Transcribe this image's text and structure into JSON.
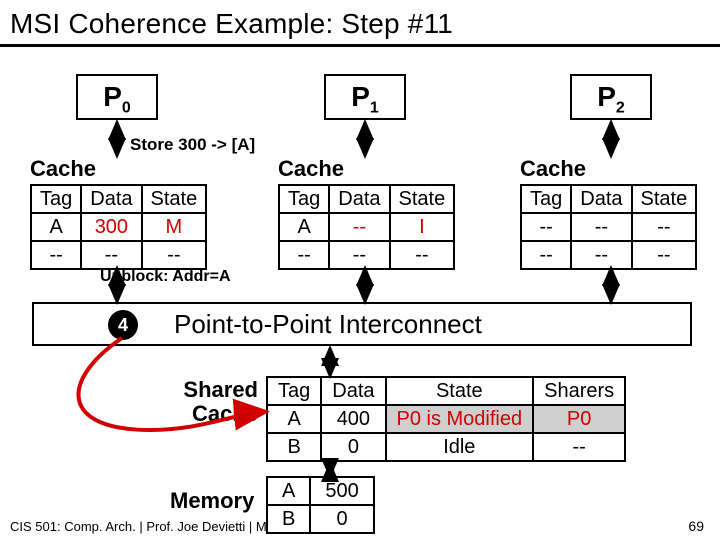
{
  "title": "MSI Coherence Example: Step #11",
  "processors": {
    "p0": "P",
    "p0sub": "0",
    "p1": "P",
    "p1sub": "1",
    "p2": "P",
    "p2sub": "2"
  },
  "store_note": "Store 300 -> [A]",
  "unblock_note": "Unblock: Addr=A",
  "cache_label": "Cache",
  "cache_headers": {
    "tag": "Tag",
    "data": "Data",
    "state": "State"
  },
  "cache0": {
    "r0": {
      "tag": "A",
      "data": "300",
      "state": "M"
    },
    "r1": {
      "tag": "--",
      "data": "--",
      "state": "--"
    }
  },
  "cache1": {
    "r0": {
      "tag": "A",
      "data": "--",
      "state": "I"
    },
    "r1": {
      "tag": "--",
      "data": "--",
      "state": "--"
    }
  },
  "cache2": {
    "r0": {
      "tag": "--",
      "data": "--",
      "state": "--"
    },
    "r1": {
      "tag": "--",
      "data": "--",
      "state": "--"
    }
  },
  "badge4": "4",
  "interconnect": "Point-to-Point Interconnect",
  "shared_label_l1": "Shared",
  "shared_label_l2": "Cache",
  "shared_headers": {
    "tag": "Tag",
    "data": "Data",
    "state": "State",
    "sharers": "Sharers"
  },
  "shared": {
    "r0": {
      "tag": "A",
      "data": "400",
      "state": "P0 is Modified",
      "sharers": "P0"
    },
    "r1": {
      "tag": "B",
      "data": "0",
      "state": "Idle",
      "sharers": "--"
    }
  },
  "memory_label": "Memory",
  "memory": {
    "r0": {
      "tag": "A",
      "data": "500"
    },
    "r1": {
      "tag": "B",
      "data": "0"
    }
  },
  "footer": "CIS 501: Comp. Arch.  |  Prof. Joe Devietti  |  M",
  "pagenum": "69"
}
